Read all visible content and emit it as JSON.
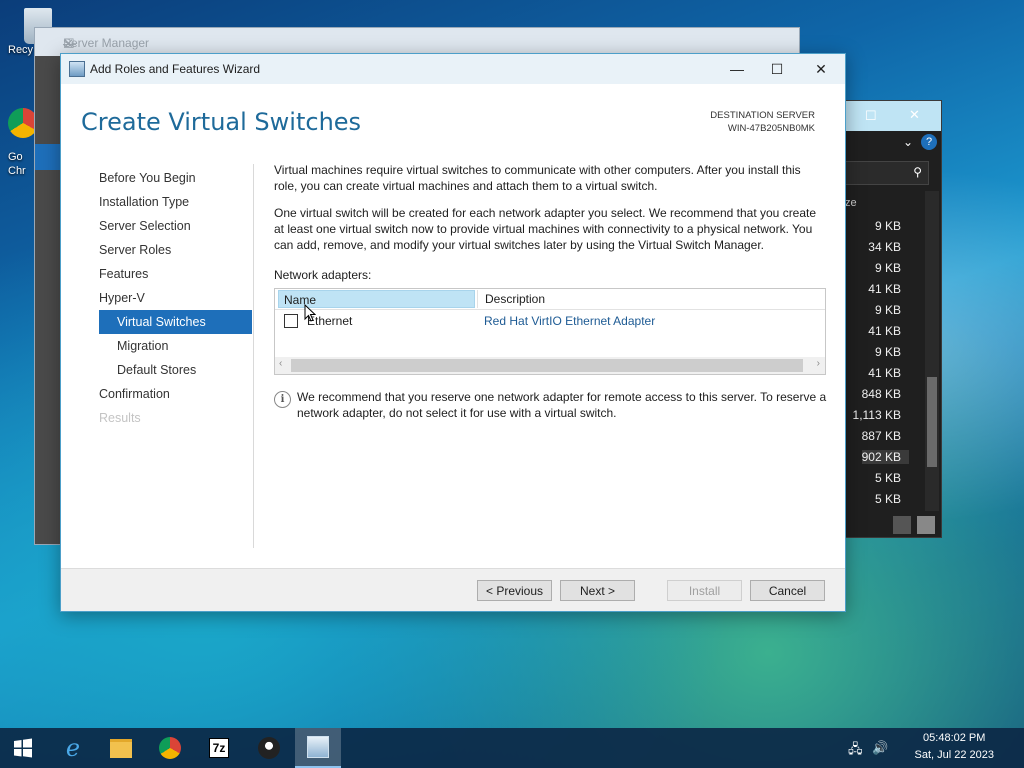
{
  "desktop": {
    "icons": [
      {
        "label": "Recy"
      },
      {
        "label": "Go Chr"
      }
    ]
  },
  "server_manager": {
    "title": "Server Manager"
  },
  "file_explorer": {
    "sizes": [
      "9 KB",
      "34 KB",
      "9 KB",
      "41 KB",
      "9 KB",
      "41 KB",
      "9 KB",
      "41 KB",
      "848 KB",
      "1,113 KB",
      "887 KB",
      "902 KB",
      "5 KB",
      "5 KB"
    ],
    "column_partial": "ze"
  },
  "wizard": {
    "title": "Add Roles and Features Wizard",
    "heading": "Create Virtual Switches",
    "destination_label": "DESTINATION SERVER",
    "destination_value": "WIN-47B205NB0MK",
    "nav": [
      {
        "label": "Before You Begin",
        "state": "normal"
      },
      {
        "label": "Installation Type",
        "state": "normal"
      },
      {
        "label": "Server Selection",
        "state": "normal"
      },
      {
        "label": "Server Roles",
        "state": "normal"
      },
      {
        "label": "Features",
        "state": "normal"
      },
      {
        "label": "Hyper-V",
        "state": "normal"
      },
      {
        "label": "Virtual Switches",
        "state": "active"
      },
      {
        "label": "Migration",
        "state": "sub"
      },
      {
        "label": "Default Stores",
        "state": "sub"
      },
      {
        "label": "Confirmation",
        "state": "normal"
      },
      {
        "label": "Results",
        "state": "disabled"
      }
    ],
    "para1": "Virtual machines require virtual switches to communicate with other computers. After you install this role, you can create virtual machines and attach them to a virtual switch.",
    "para2": "One virtual switch will be created for each network adapter you select. We recommend that you create at least one virtual switch now to provide virtual machines with connectivity to a physical network. You can add, remove, and modify your virtual switches later by using the Virtual Switch Manager.",
    "adapters_label": "Network adapters:",
    "grid": {
      "col_name": "Name",
      "col_desc": "Description",
      "rows": [
        {
          "name": "Ethernet",
          "description": "Red Hat VirtIO Ethernet Adapter",
          "checked": false
        }
      ]
    },
    "info": "We recommend that you reserve one network adapter for remote access to this server. To reserve a network adapter, do not select it for use with a virtual switch.",
    "buttons": {
      "previous": "< Previous",
      "next": "Next >",
      "install": "Install",
      "cancel": "Cancel"
    }
  },
  "taskbar": {
    "time": "05:48:02 PM",
    "date": "Sat, Jul 22 2023",
    "apps": [
      "start-icon",
      "ie-icon",
      "file-explorer-icon",
      "chrome-icon",
      "7zip-icon",
      "app-icon",
      "server-manager-icon"
    ],
    "sevenzip_label": "7z"
  }
}
